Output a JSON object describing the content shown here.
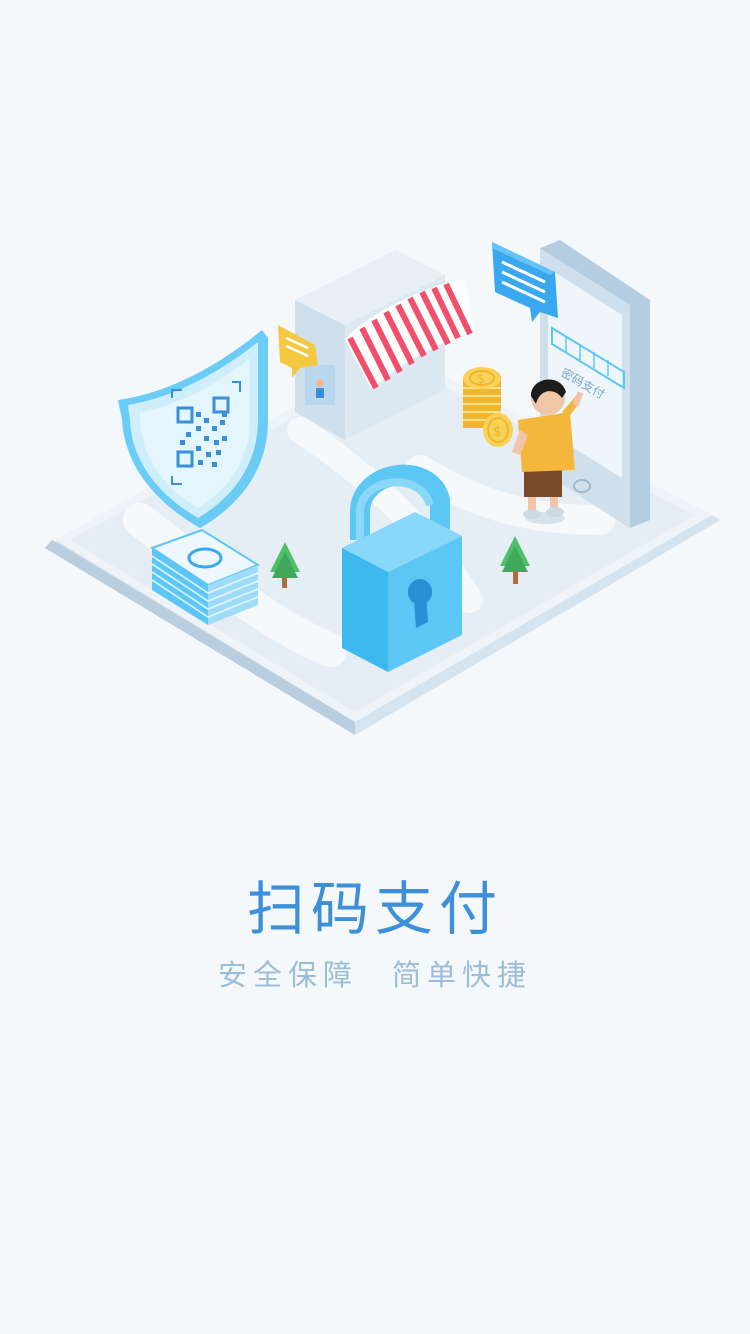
{
  "onboarding": {
    "title": "扫码支付",
    "subtitle_left": "安全保障",
    "subtitle_right": "简单快捷",
    "phone_label": "密码支付",
    "colors": {
      "background": "#f5f8fb",
      "title": "#3d8fd8",
      "subtitle": "#9bbdd8",
      "accent_blue": "#5cc7f5",
      "awning_red": "#f0506b",
      "coin_gold": "#f5c842"
    },
    "icons": [
      "shield-qr-icon",
      "padlock-icon",
      "shop-icon",
      "phone-icon",
      "coins-icon",
      "money-stack-icon",
      "chat-bubble-icon",
      "tree-icon",
      "person-icon"
    ]
  }
}
